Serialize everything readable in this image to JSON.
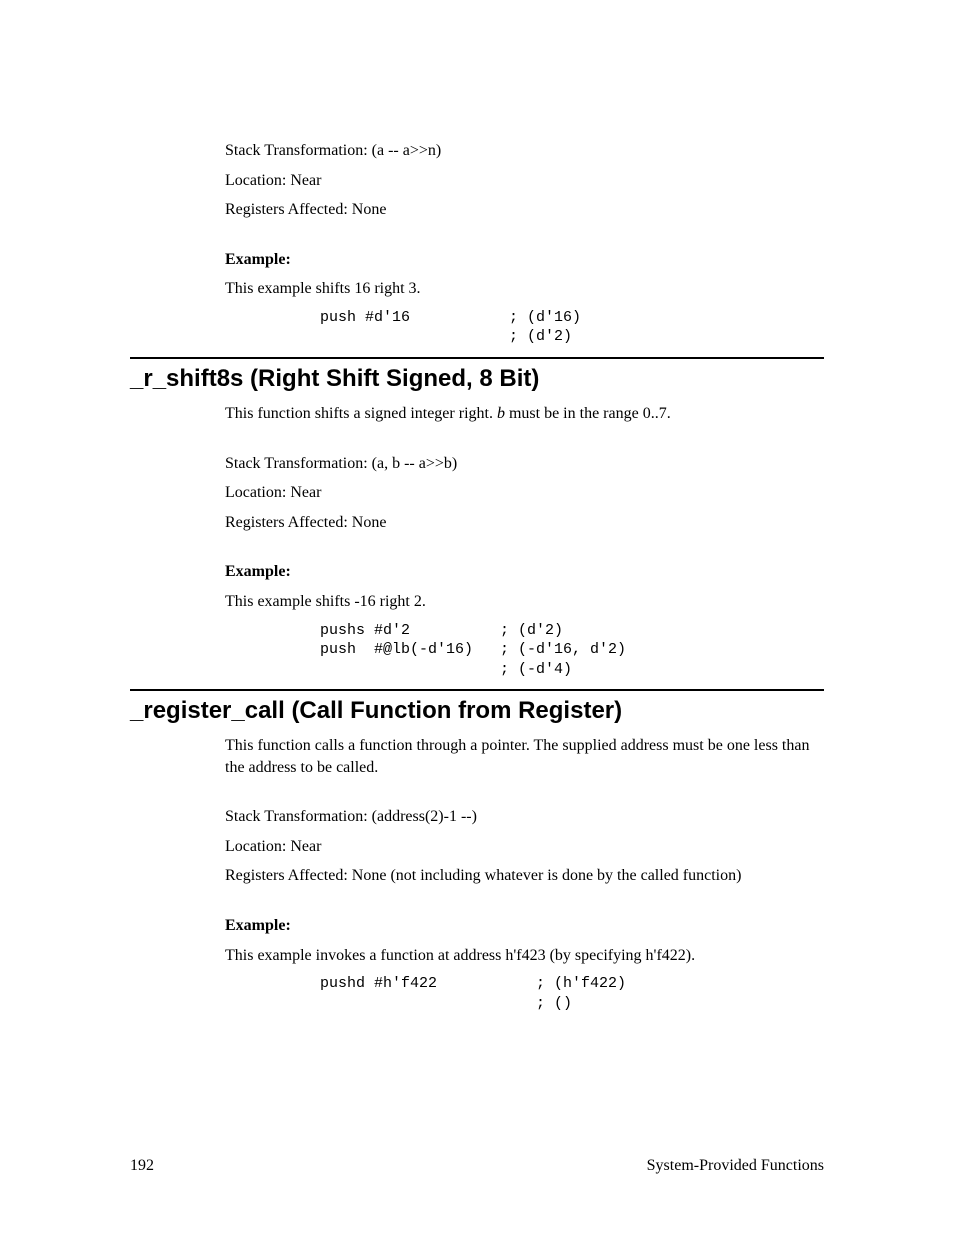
{
  "top": {
    "stack": "Stack Transformation:  (a -- a>>n)",
    "location": "Location:  Near",
    "registers": "Registers Affected:  None",
    "exampleLabel": "Example:",
    "exampleDesc": "This example shifts 16 right 3.",
    "code": "push #d'16           ; (d'16)\n                     ; (d'2)"
  },
  "sec1": {
    "heading": "_r_shift8s (Right Shift Signed, 8 Bit)",
    "desc_a": "This function shifts a signed integer right.  ",
    "desc_b": "b",
    "desc_c": " must be in the range 0..7.",
    "stack": "Stack Transformation:  (a, b -- a>>b)",
    "location": "Location:  Near",
    "registers": "Registers Affected:  None",
    "exampleLabel": "Example:",
    "exampleDesc": "This example shifts -16 right 2.",
    "code": "pushs #d'2          ; (d'2)\npush  #@lb(-d'16)   ; (-d'16, d'2)\n                    ; (-d'4)"
  },
  "sec2": {
    "heading": "_register_call (Call Function from Register)",
    "desc": "This function calls a function through a pointer.  The supplied address must be one less than the address to be called.",
    "stack": "Stack Transformation:  (address(2)-1 --)",
    "location": "Location:  Near",
    "registers": "Registers Affected:  None (not including whatever is done by the called function)",
    "exampleLabel": "Example:",
    "exampleDesc": "This example invokes a function at address h'f423 (by specifying h'f422).",
    "code": "pushd #h'f422           ; (h'f422)\n                        ; ()"
  },
  "footer": {
    "pageNumber": "192",
    "chapter": "System-Provided Functions"
  }
}
